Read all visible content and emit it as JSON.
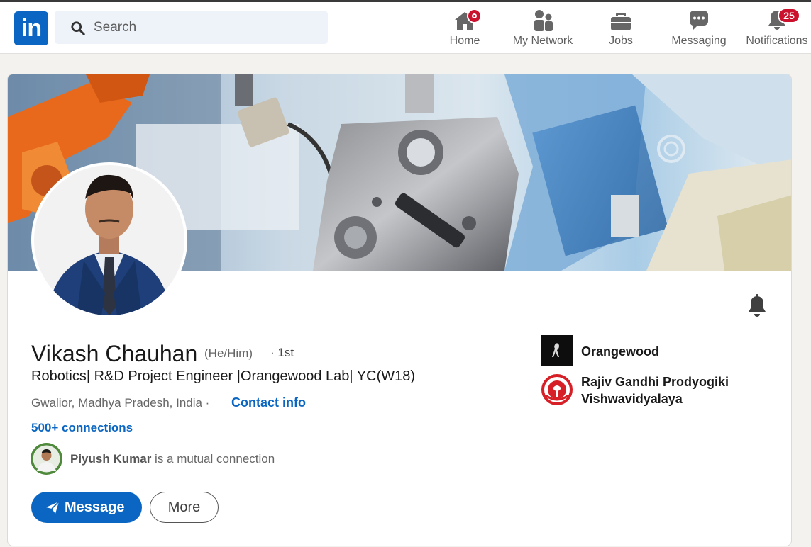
{
  "nav": {
    "logo_text": "in",
    "search_placeholder": "Search",
    "items": [
      {
        "label": "Home",
        "icon": "home-icon",
        "badge": ""
      },
      {
        "label": "My Network",
        "icon": "network-icon",
        "badge": ""
      },
      {
        "label": "Jobs",
        "icon": "briefcase-icon",
        "badge": ""
      },
      {
        "label": "Messaging",
        "icon": "messaging-icon",
        "badge": ""
      },
      {
        "label": "Notifications",
        "icon": "bell-icon",
        "badge": "25"
      }
    ]
  },
  "profile": {
    "name": "Vikash Chauhan",
    "pronouns": "(He/Him)",
    "degree": "· 1st",
    "headline": "Robotics| R&D Project Engineer |Orangewood Lab| YC(W18)",
    "location": "Gwalior, Madhya Pradesh, India ·",
    "contact_label": "Contact info",
    "connections": "500+ connections",
    "mutual_name": "Piyush Kumar",
    "mutual_text": "is a mutual connection",
    "message_button": "Message",
    "more_button": "More"
  },
  "organizations": [
    {
      "name": "Orangewood",
      "icon": "orangewood-logo"
    },
    {
      "name_line1": "Rajiv Gandhi Prodyogiki",
      "name_line2": "Vishwavidyalaya",
      "icon": "rgpv-logo"
    }
  ],
  "colors": {
    "brand": "#0a66c2",
    "badge": "#cb112d",
    "background": "#f4f2ee"
  }
}
